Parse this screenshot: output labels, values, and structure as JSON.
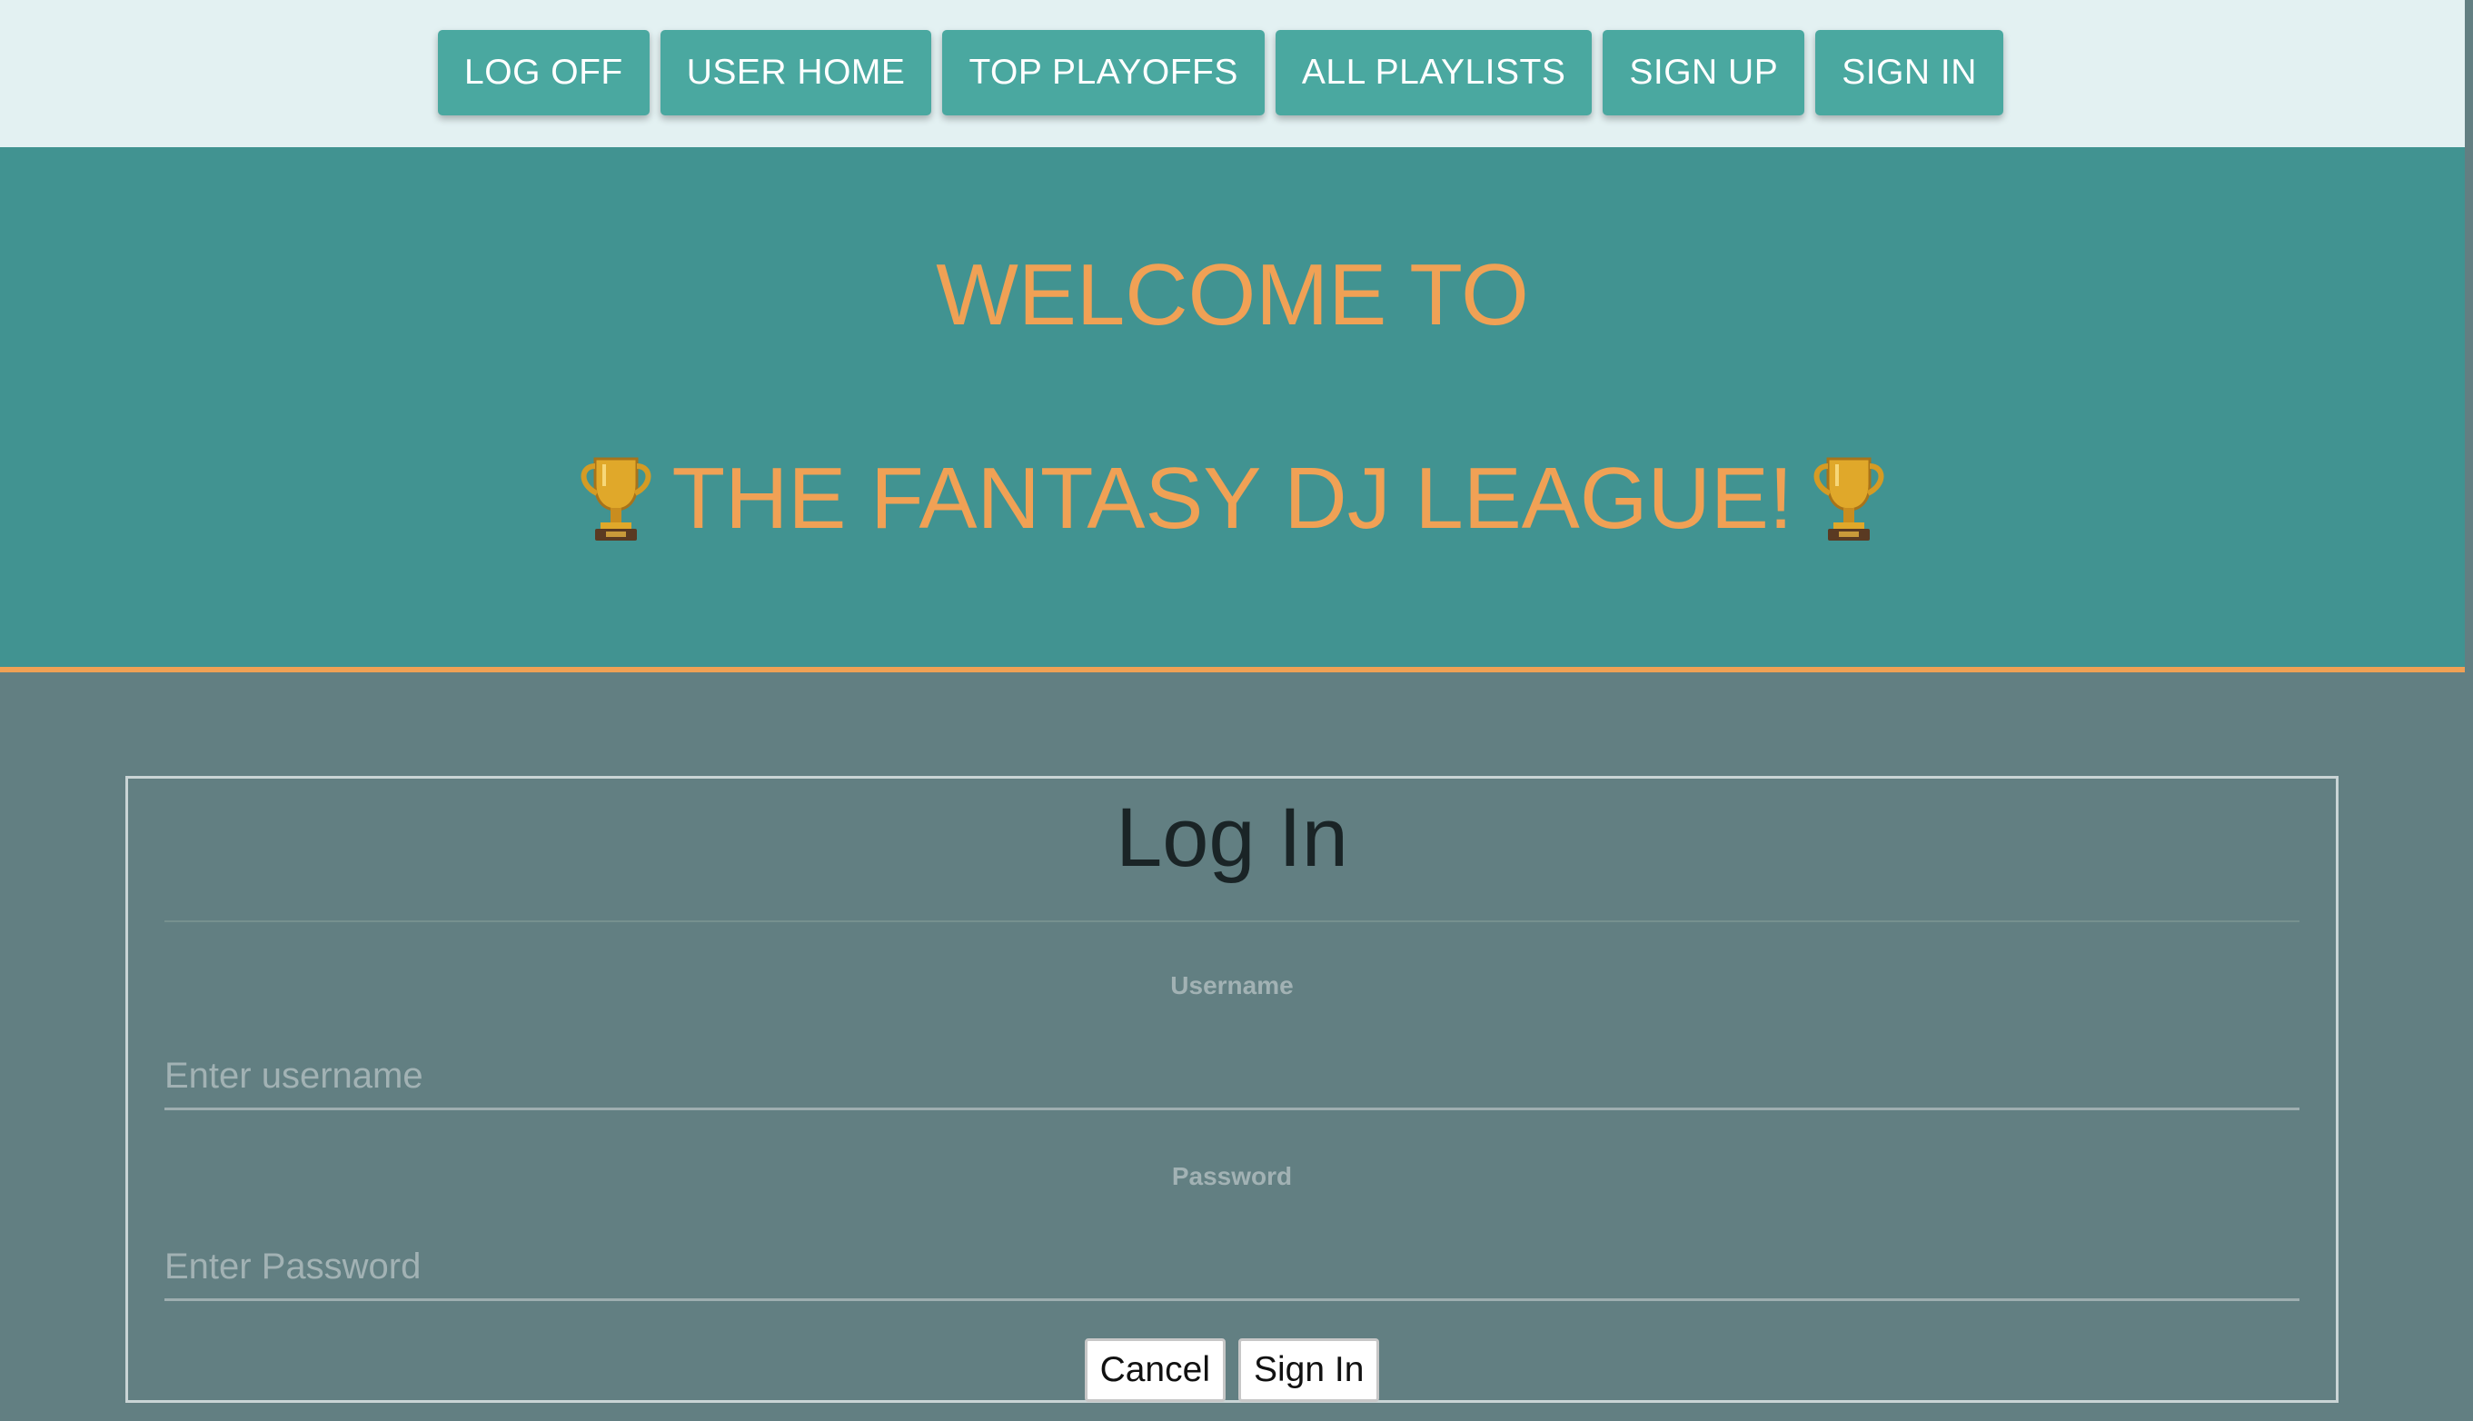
{
  "nav": {
    "buttons": [
      {
        "label": "LOG OFF"
      },
      {
        "label": "USER HOME"
      },
      {
        "label": "TOP PLAYOFFS"
      },
      {
        "label": "ALL PLAYLISTS"
      },
      {
        "label": "SIGN UP"
      },
      {
        "label": "SIGN IN"
      }
    ]
  },
  "hero": {
    "line1": "WELCOME TO",
    "line2": "THE FANTASY DJ LEAGUE!",
    "icon": "trophy-icon"
  },
  "login": {
    "title": "Log In",
    "username_label": "Username",
    "username_placeholder": "Enter username",
    "password_label": "Password",
    "password_placeholder": "Enter Password",
    "cancel_label": "Cancel",
    "submit_label": "Sign In"
  },
  "colors": {
    "nav_background": "#e3f1f2",
    "nav_button": "#4aa8a0",
    "hero_background": "#419391",
    "accent_orange": "#f0a155",
    "body_background": "#627f82"
  }
}
